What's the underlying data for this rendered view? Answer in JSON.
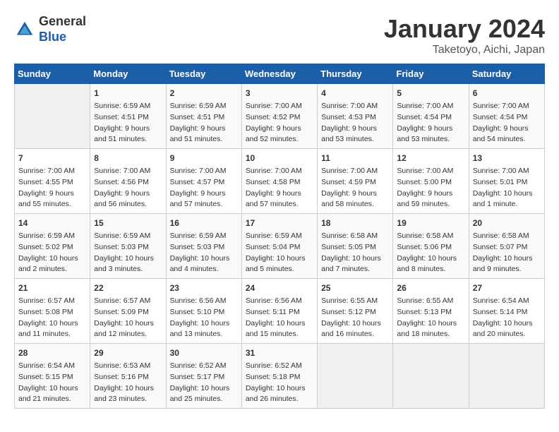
{
  "header": {
    "logo_line1": "General",
    "logo_line2": "Blue",
    "month": "January 2024",
    "location": "Taketoyo, Aichi, Japan"
  },
  "days_of_week": [
    "Sunday",
    "Monday",
    "Tuesday",
    "Wednesday",
    "Thursday",
    "Friday",
    "Saturday"
  ],
  "weeks": [
    [
      {
        "day": "",
        "content": ""
      },
      {
        "day": "1",
        "content": "Sunrise: 6:59 AM\nSunset: 4:51 PM\nDaylight: 9 hours\nand 51 minutes."
      },
      {
        "day": "2",
        "content": "Sunrise: 6:59 AM\nSunset: 4:51 PM\nDaylight: 9 hours\nand 51 minutes."
      },
      {
        "day": "3",
        "content": "Sunrise: 7:00 AM\nSunset: 4:52 PM\nDaylight: 9 hours\nand 52 minutes."
      },
      {
        "day": "4",
        "content": "Sunrise: 7:00 AM\nSunset: 4:53 PM\nDaylight: 9 hours\nand 53 minutes."
      },
      {
        "day": "5",
        "content": "Sunrise: 7:00 AM\nSunset: 4:54 PM\nDaylight: 9 hours\nand 53 minutes."
      },
      {
        "day": "6",
        "content": "Sunrise: 7:00 AM\nSunset: 4:54 PM\nDaylight: 9 hours\nand 54 minutes."
      }
    ],
    [
      {
        "day": "7",
        "content": "Sunrise: 7:00 AM\nSunset: 4:55 PM\nDaylight: 9 hours\nand 55 minutes."
      },
      {
        "day": "8",
        "content": "Sunrise: 7:00 AM\nSunset: 4:56 PM\nDaylight: 9 hours\nand 56 minutes."
      },
      {
        "day": "9",
        "content": "Sunrise: 7:00 AM\nSunset: 4:57 PM\nDaylight: 9 hours\nand 57 minutes."
      },
      {
        "day": "10",
        "content": "Sunrise: 7:00 AM\nSunset: 4:58 PM\nDaylight: 9 hours\nand 57 minutes."
      },
      {
        "day": "11",
        "content": "Sunrise: 7:00 AM\nSunset: 4:59 PM\nDaylight: 9 hours\nand 58 minutes."
      },
      {
        "day": "12",
        "content": "Sunrise: 7:00 AM\nSunset: 5:00 PM\nDaylight: 9 hours\nand 59 minutes."
      },
      {
        "day": "13",
        "content": "Sunrise: 7:00 AM\nSunset: 5:01 PM\nDaylight: 10 hours\nand 1 minute."
      }
    ],
    [
      {
        "day": "14",
        "content": "Sunrise: 6:59 AM\nSunset: 5:02 PM\nDaylight: 10 hours\nand 2 minutes."
      },
      {
        "day": "15",
        "content": "Sunrise: 6:59 AM\nSunset: 5:03 PM\nDaylight: 10 hours\nand 3 minutes."
      },
      {
        "day": "16",
        "content": "Sunrise: 6:59 AM\nSunset: 5:03 PM\nDaylight: 10 hours\nand 4 minutes."
      },
      {
        "day": "17",
        "content": "Sunrise: 6:59 AM\nSunset: 5:04 PM\nDaylight: 10 hours\nand 5 minutes."
      },
      {
        "day": "18",
        "content": "Sunrise: 6:58 AM\nSunset: 5:05 PM\nDaylight: 10 hours\nand 7 minutes."
      },
      {
        "day": "19",
        "content": "Sunrise: 6:58 AM\nSunset: 5:06 PM\nDaylight: 10 hours\nand 8 minutes."
      },
      {
        "day": "20",
        "content": "Sunrise: 6:58 AM\nSunset: 5:07 PM\nDaylight: 10 hours\nand 9 minutes."
      }
    ],
    [
      {
        "day": "21",
        "content": "Sunrise: 6:57 AM\nSunset: 5:08 PM\nDaylight: 10 hours\nand 11 minutes."
      },
      {
        "day": "22",
        "content": "Sunrise: 6:57 AM\nSunset: 5:09 PM\nDaylight: 10 hours\nand 12 minutes."
      },
      {
        "day": "23",
        "content": "Sunrise: 6:56 AM\nSunset: 5:10 PM\nDaylight: 10 hours\nand 13 minutes."
      },
      {
        "day": "24",
        "content": "Sunrise: 6:56 AM\nSunset: 5:11 PM\nDaylight: 10 hours\nand 15 minutes."
      },
      {
        "day": "25",
        "content": "Sunrise: 6:55 AM\nSunset: 5:12 PM\nDaylight: 10 hours\nand 16 minutes."
      },
      {
        "day": "26",
        "content": "Sunrise: 6:55 AM\nSunset: 5:13 PM\nDaylight: 10 hours\nand 18 minutes."
      },
      {
        "day": "27",
        "content": "Sunrise: 6:54 AM\nSunset: 5:14 PM\nDaylight: 10 hours\nand 20 minutes."
      }
    ],
    [
      {
        "day": "28",
        "content": "Sunrise: 6:54 AM\nSunset: 5:15 PM\nDaylight: 10 hours\nand 21 minutes."
      },
      {
        "day": "29",
        "content": "Sunrise: 6:53 AM\nSunset: 5:16 PM\nDaylight: 10 hours\nand 23 minutes."
      },
      {
        "day": "30",
        "content": "Sunrise: 6:52 AM\nSunset: 5:17 PM\nDaylight: 10 hours\nand 25 minutes."
      },
      {
        "day": "31",
        "content": "Sunrise: 6:52 AM\nSunset: 5:18 PM\nDaylight: 10 hours\nand 26 minutes."
      },
      {
        "day": "",
        "content": ""
      },
      {
        "day": "",
        "content": ""
      },
      {
        "day": "",
        "content": ""
      }
    ]
  ]
}
